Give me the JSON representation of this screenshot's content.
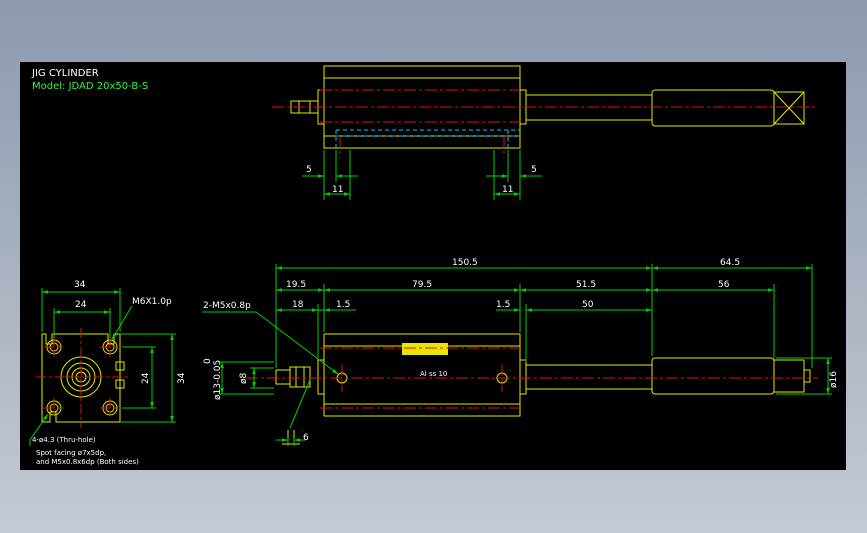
{
  "title": "JIG CYLINDER",
  "model": "Model: JDAD 20x50-B-S",
  "colors": {
    "background": "#000000",
    "outline": "#e6e600",
    "dimension": "#00d000",
    "centerline": "#e01010",
    "hidden": "#00c8ff",
    "text": "#ffffff",
    "model_text": "#3df03d"
  },
  "top_view": {
    "dims": {
      "left_5": "5",
      "left_11": "11",
      "right_11": "11",
      "right_5": "5"
    }
  },
  "end_view": {
    "dims": {
      "w34": "34",
      "w24": "24",
      "thread": "M6X1.0p",
      "h24": "24",
      "h34": "34"
    },
    "notes": {
      "holes": "4-ø4.3 (Thru-hole)",
      "spot1": "Spot facing ø7x5dp,",
      "spot2": "and M5x0.8x6dp (Both sides)"
    }
  },
  "front_view": {
    "dims": {
      "overall": "150.5",
      "stroke_ext": "64.5",
      "d19_5": "19.5",
      "d79_5": "79.5",
      "d51_5": "51.5",
      "d56": "56",
      "d18": "18",
      "d1_5a": "1.5",
      "d1_5b": "1.5",
      "d50": "50",
      "ports": "2-M5x0.8p",
      "tol_upper": "0",
      "tol_main": "ø13-0.05",
      "rod_dia": "ø8",
      "ext_dia": "ø16",
      "d6": "6"
    },
    "label_mark": "Al ss 10"
  }
}
